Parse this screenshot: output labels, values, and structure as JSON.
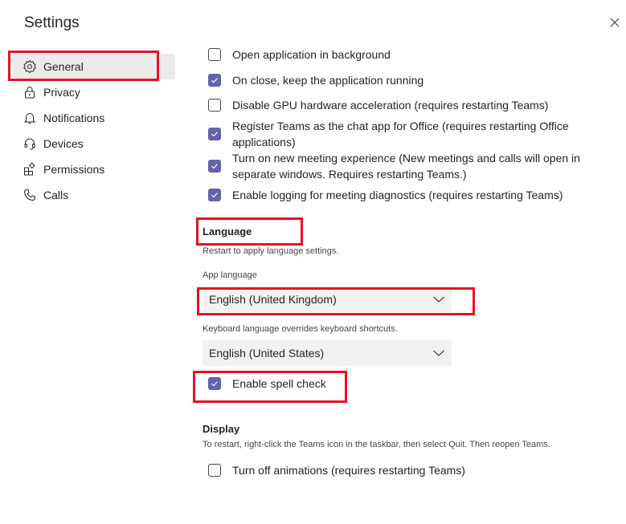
{
  "header": {
    "title": "Settings",
    "close_icon": "close-icon"
  },
  "sidebar": {
    "items": [
      {
        "label": "General",
        "icon": "gear-icon",
        "active": true
      },
      {
        "label": "Privacy",
        "icon": "lock-icon",
        "active": false
      },
      {
        "label": "Notifications",
        "icon": "bell-icon",
        "active": false
      },
      {
        "label": "Devices",
        "icon": "headset-icon",
        "active": false
      },
      {
        "label": "Permissions",
        "icon": "apps-icon",
        "active": false
      },
      {
        "label": "Calls",
        "icon": "phone-icon",
        "active": false
      }
    ]
  },
  "application": {
    "options": [
      {
        "label": "Open application in background",
        "checked": false
      },
      {
        "label": "On close, keep the application running",
        "checked": true
      },
      {
        "label": "Disable GPU hardware acceleration (requires restarting Teams)",
        "checked": false
      },
      {
        "label": "Register Teams as the chat app for Office (requires restarting Office applications)",
        "checked": true
      },
      {
        "label": "Turn on new meeting experience (New meetings and calls will open in separate windows. Requires restarting Teams.)",
        "checked": true
      },
      {
        "label": "Enable logging for meeting diagnostics (requires restarting Teams)",
        "checked": true
      }
    ]
  },
  "language": {
    "title": "Language",
    "subtitle": "Restart to apply language settings.",
    "app_language_label": "App language",
    "app_language_value": "English (United Kingdom)",
    "keyboard_label": "Keyboard language overrides keyboard shortcuts.",
    "keyboard_value": "English (United States)",
    "spell_check_label": "Enable spell check",
    "spell_check_checked": true
  },
  "display": {
    "title": "Display",
    "subtitle": "To restart, right-click the Teams icon in the taskbar, then select Quit. Then reopen Teams.",
    "animations_label": "Turn off animations (requires restarting Teams)",
    "animations_checked": false
  },
  "colors": {
    "accent": "#6264a7",
    "highlight": "#e81123"
  }
}
